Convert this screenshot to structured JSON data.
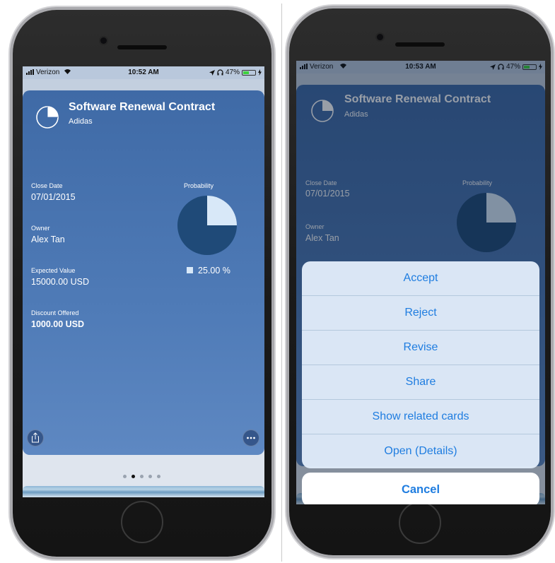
{
  "status_left": {
    "carrier": "Verizon",
    "time": "10:52 AM",
    "battery": "47%"
  },
  "status_right": {
    "carrier": "Verizon",
    "time": "10:53 AM",
    "battery": "47%"
  },
  "card": {
    "title": "Software Renewal Contract",
    "subtitle": "Adidas",
    "fields": [
      {
        "label": "Close Date",
        "value": "07/01/2015"
      },
      {
        "label": "Owner",
        "value": "Alex Tan"
      },
      {
        "label": "Expected Value",
        "value": "15000.00 USD"
      },
      {
        "label": "Discount Offered",
        "value": "1000.00 USD"
      }
    ],
    "probability": {
      "label": "Probability",
      "legend": "25.00 %",
      "fraction": 0.25
    }
  },
  "pager": {
    "count": 5,
    "active": 1
  },
  "action_sheet": {
    "options": [
      "Accept",
      "Reject",
      "Revise",
      "Share",
      "Show related cards",
      "Open (Details)"
    ],
    "cancel": "Cancel"
  },
  "icons": [
    "signal-icon",
    "wifi-icon",
    "location-icon",
    "headphones-icon",
    "battery-icon",
    "charging-icon",
    "pie-chart-icon",
    "share-icon",
    "more-icon"
  ],
  "colors": {
    "accent": "#1f7de0",
    "card": "#4a76b3",
    "pie_dark": "#1f4a78",
    "pie_light": "#d8e8f8",
    "battery": "#3dd23d"
  }
}
